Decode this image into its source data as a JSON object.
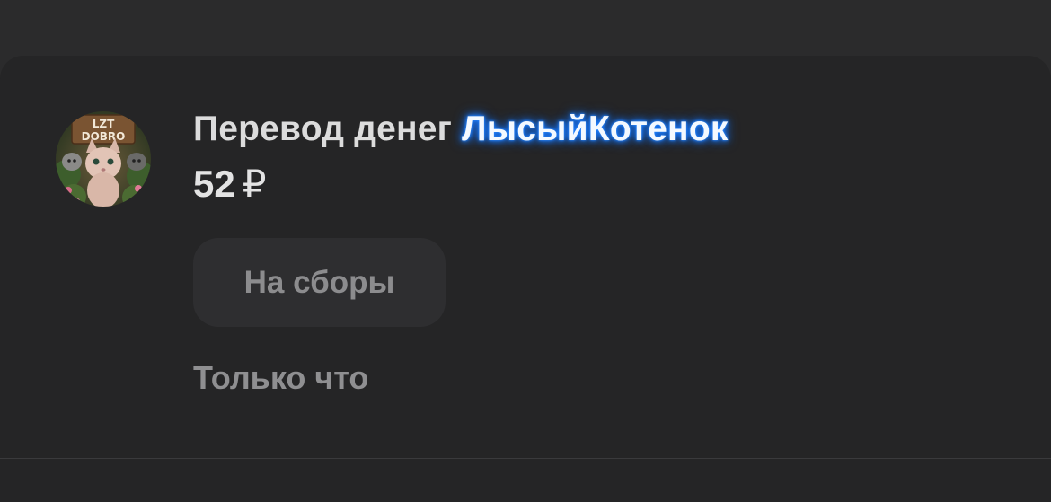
{
  "transaction": {
    "title_prefix": "Перевод денег ",
    "nickname": "ЛысыйКотенок",
    "amount": "52",
    "currency": "₽",
    "purpose_label": "На сборы",
    "time": "Только что"
  },
  "avatar": {
    "logo_text_top": "LZT",
    "logo_text_bottom": "DOBRO",
    "icon": "cat-avatar-icon"
  },
  "colors": {
    "background": "#2b2b2c",
    "card": "#252526",
    "nickname_glow": "#1a7bff",
    "primary_text": "#dcdcdc",
    "secondary_text": "#8f8f91"
  }
}
